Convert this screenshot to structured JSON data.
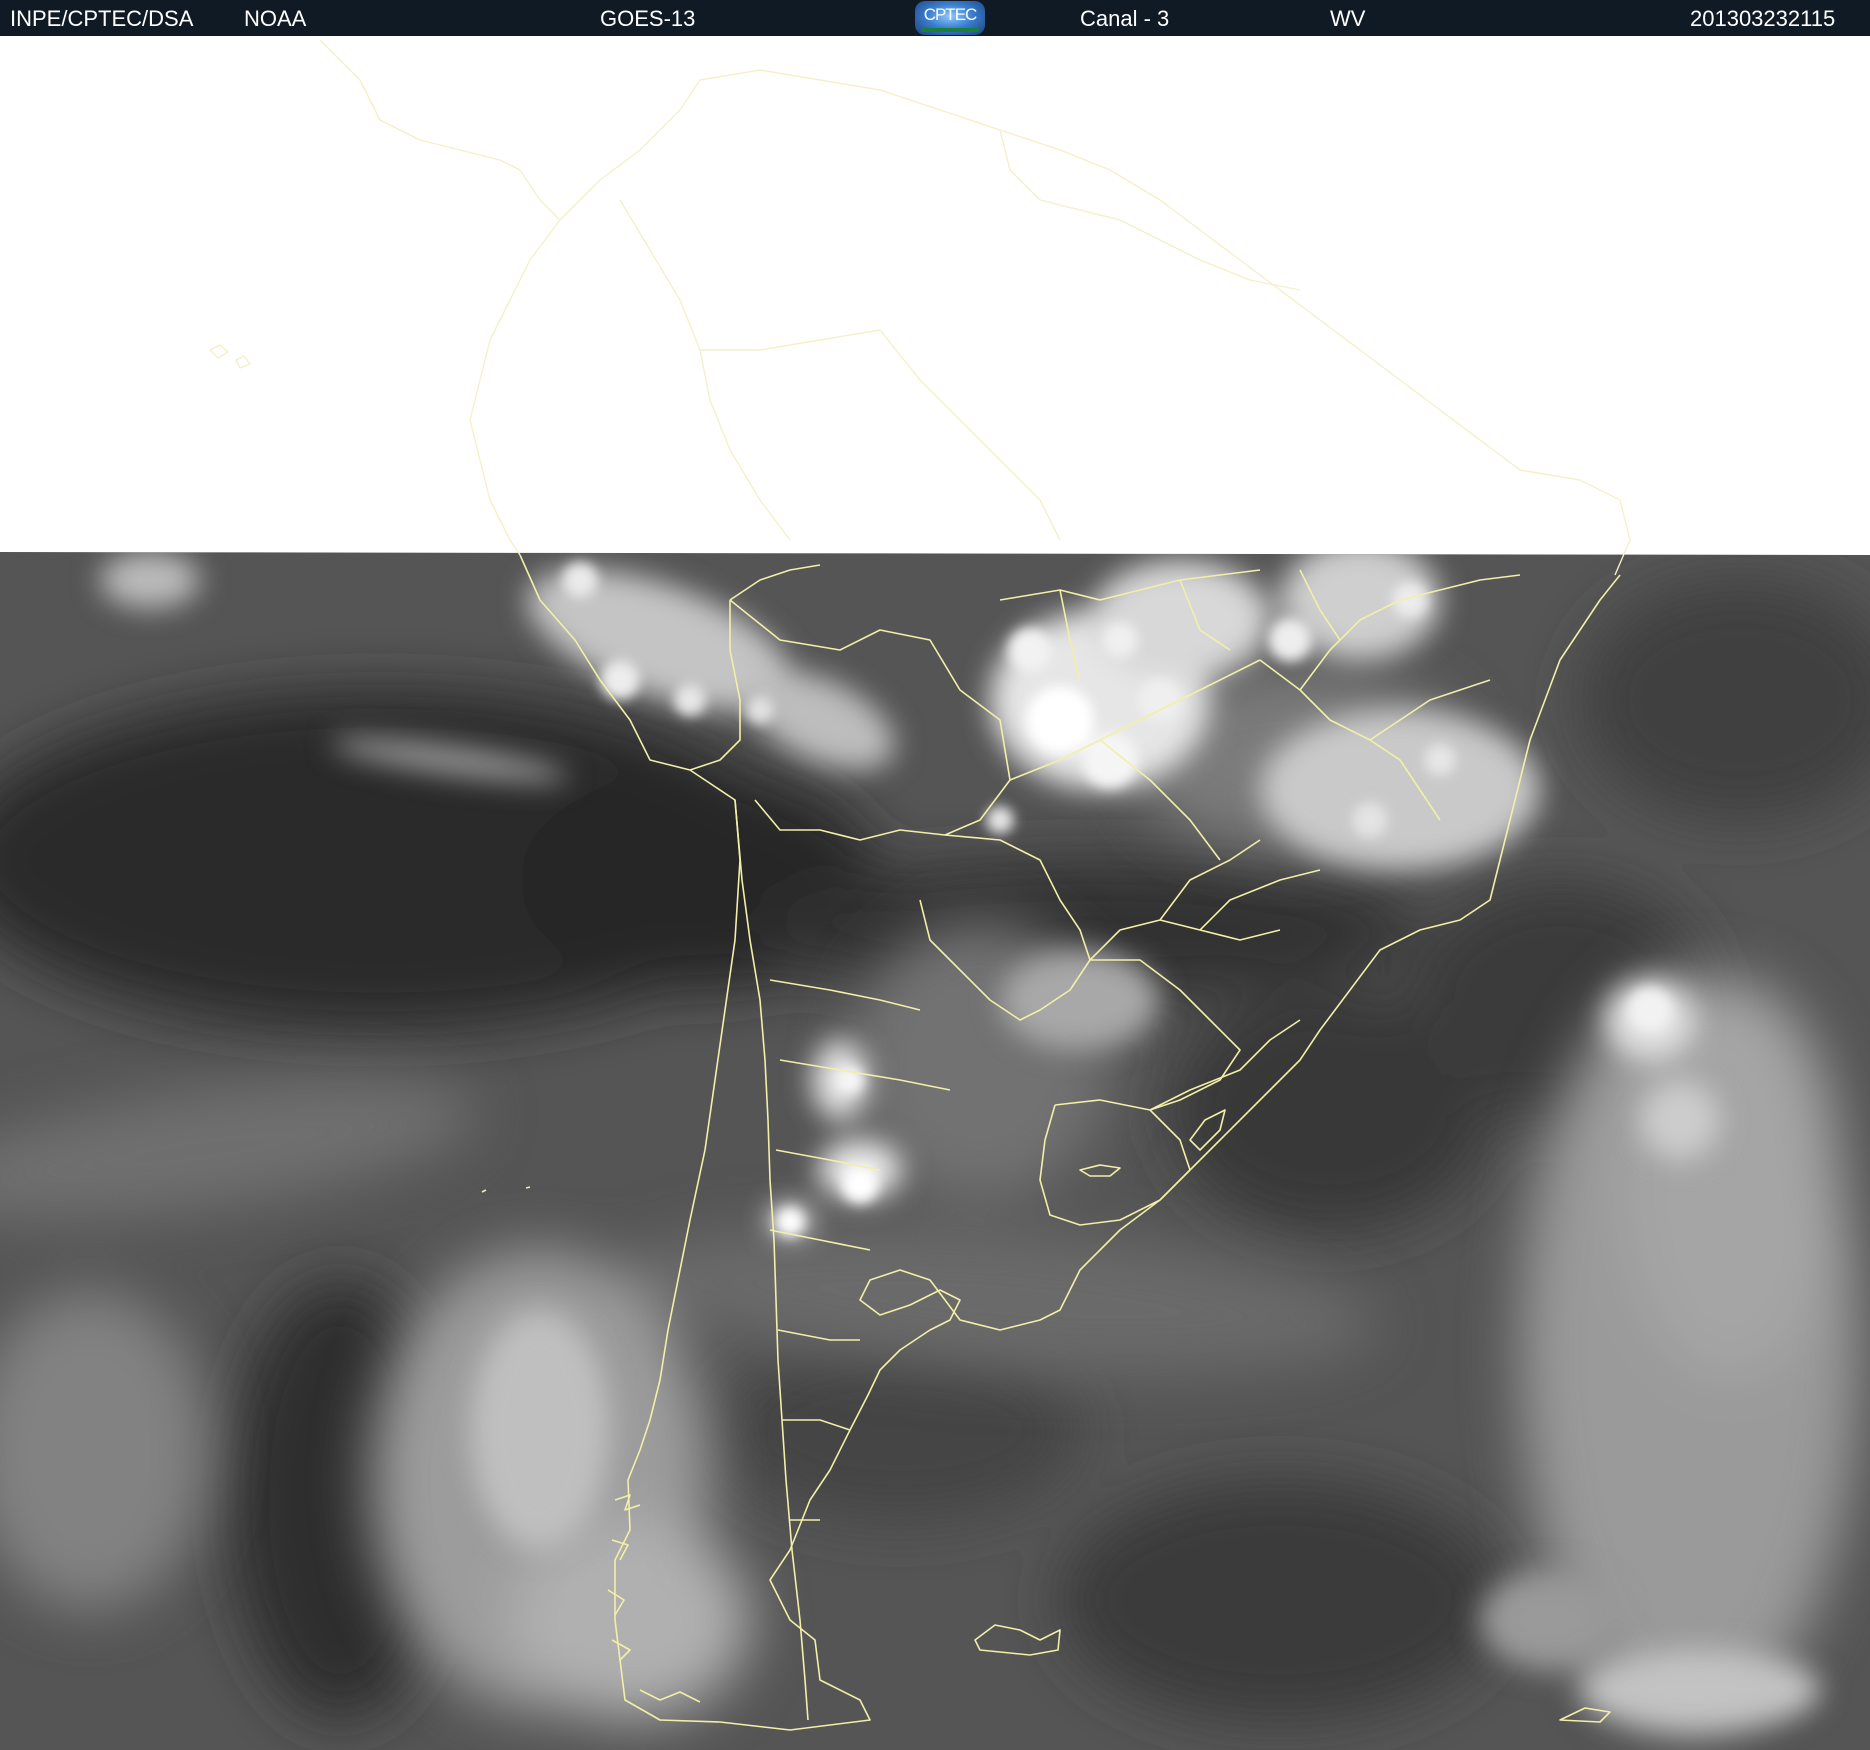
{
  "header": {
    "institution": "INPE/CPTEC/DSA",
    "agency": "NOAA",
    "satellite": "GOES-13",
    "logo_text": "CPTEC",
    "channel": "Canal - 3",
    "band": "WV",
    "timestamp": "201303232115"
  },
  "map": {
    "boundary_color": "#f2efa8",
    "no_data_color": "#ffffff",
    "imagery_colors": {
      "dry_dark": "#262626",
      "mid_gray": "#555555",
      "moist_light": "#d9d9d9",
      "cloud_white": "#f7f7f7"
    }
  }
}
